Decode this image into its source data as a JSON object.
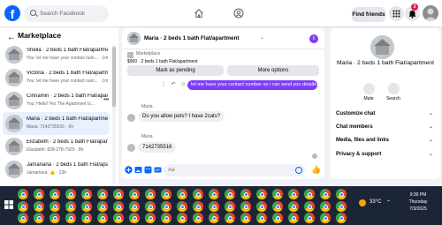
{
  "topbar": {
    "logo": "f",
    "search_placeholder": "Search Facebook",
    "find_friends": "Find friends",
    "notification_count": "3"
  },
  "marketplace": {
    "title": "Marketplace",
    "back": "←",
    "conversations": [
      {
        "name": "Sheila · 2 beds 1 bath Flat/apartment",
        "preview": "You: let me have your contact num... · 1m",
        "active": false
      },
      {
        "name": "Victoria · 2 beds 1 bath Flat/apartment",
        "preview": "You: let me have your contact num... · 1m",
        "active": false
      },
      {
        "name": "Cinnamin · 2 beds 1 bath Flat/apar...",
        "preview": "You: Hello! Yes The Apartment Is...",
        "active": false,
        "more": "•••"
      },
      {
        "name": "Maria · 2 beds 1 bath Flat/apartment",
        "preview": "Maria: 7142735516 · 6h",
        "active": true
      },
      {
        "name": "Elizabeth · 2 beds 1 bath Flat/apartment",
        "preview": "Elizabeth: 828-278-7920 · 8h",
        "active": false
      },
      {
        "name": "Jamariana · 2 beds 1 bath Flat/apartment",
        "preview": "Jamariana: 👍 · 23h",
        "active": false
      }
    ]
  },
  "chat": {
    "title": "Maria · 2 beds 1 bath Flat/apartment",
    "listing_label": "Marketplace",
    "listing_price": "$900 · 2 beds 1 bath Flat/apartment",
    "mark_pending": "Mark as pending",
    "more_options": "More options",
    "outgoing": "let me have your contact number so i can send you details",
    "messages": [
      {
        "sender": "Maria",
        "text": "Do you allow pets? I have 2cats?"
      },
      {
        "sender": "Maria",
        "text": "7142735516"
      }
    ],
    "composer_placeholder": "Aa"
  },
  "info_panel": {
    "title": "Maria · 2 beds 1 bath Flat/apartment",
    "mute": "Mute",
    "search": "Search",
    "rows": [
      "Customize chat",
      "Chat members",
      "Media, files and links",
      "Privacy & support"
    ]
  },
  "taskbar": {
    "temperature": "33°C",
    "time": "9:39 PM",
    "day": "Thursday",
    "date": "7/3/2025"
  },
  "colors": {
    "brand": "#0866ff",
    "accent": "#7d3ff2",
    "taskbar": "#1c2535"
  }
}
